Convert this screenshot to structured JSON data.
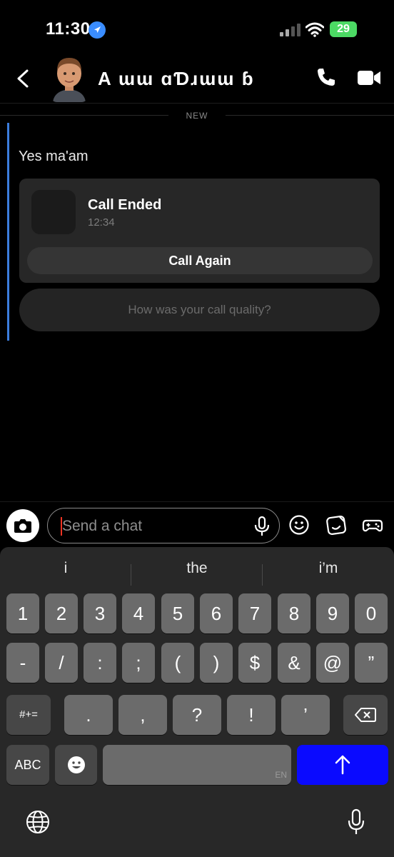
{
  "status_bar": {
    "time": "11:30",
    "battery": "29"
  },
  "header": {
    "contact_name": "A ɯɯ ɑƊɹɯɯ ɓ"
  },
  "chat": {
    "divider_label": "NEW",
    "message": "Yes ma'am",
    "call_card": {
      "title": "Call Ended",
      "time": "12:34",
      "action_label": "Call Again"
    },
    "quality_prompt": "How was your call quality?"
  },
  "input": {
    "placeholder": "Send a chat"
  },
  "keyboard": {
    "suggestions": [
      "i",
      "the",
      "i’m"
    ],
    "row1": [
      "1",
      "2",
      "3",
      "4",
      "5",
      "6",
      "7",
      "8",
      "9",
      "0"
    ],
    "row2": [
      "-",
      "/",
      ":",
      ";",
      "(",
      ")",
      "$",
      "&",
      "@",
      "”"
    ],
    "row3": [
      "#+=",
      ".",
      ",",
      "?",
      "!",
      "’"
    ],
    "abc_label": "ABC",
    "space_label": "EN"
  },
  "colors": {
    "accent": "#3b7ddd",
    "send_key": "#0a0aff",
    "battery": "#4cd964"
  },
  "icons": [
    "back-icon",
    "phone-icon",
    "video-icon",
    "camera-icon",
    "mic-icon",
    "emoji-icon",
    "sticker-icon",
    "game-icon",
    "globe-icon",
    "backspace-icon",
    "arrow-up-icon"
  ]
}
